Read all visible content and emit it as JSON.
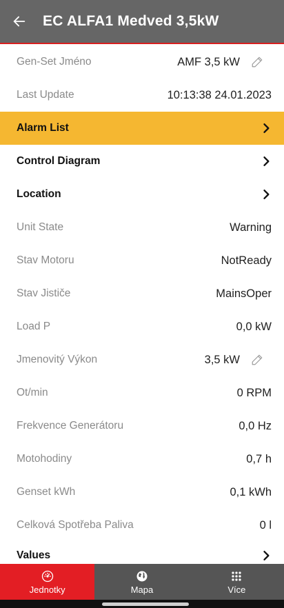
{
  "app_bar": {
    "title": "EC ALFA1 Medved 3,5kW",
    "back_icon": "arrow-left-icon"
  },
  "rows": {
    "genset_name": {
      "label": "Gen-Set Jméno",
      "value": "AMF 3,5 kW",
      "edit_icon": "pencil-icon"
    },
    "last_update": {
      "label": "Last Update",
      "value": "10:13:38 24.01.2023"
    },
    "alarm_list": {
      "label": "Alarm List",
      "icon": "chevron-right-icon",
      "highlight_color": "#f5b731"
    },
    "control_diagram": {
      "label": "Control Diagram",
      "icon": "chevron-right-icon"
    },
    "location": {
      "label": "Location",
      "icon": "chevron-right-icon"
    },
    "unit_state": {
      "label": "Unit State",
      "value": "Warning"
    },
    "stav_motoru": {
      "label": "Stav Motoru",
      "value": "NotReady"
    },
    "stav_jistice": {
      "label": "Stav Jističe",
      "value": "MainsOper"
    },
    "load_p": {
      "label": "Load P",
      "value": "0,0 kW"
    },
    "jmenovity_vykon": {
      "label": "Jmenovitý Výkon",
      "value": "3,5 kW",
      "edit_icon": "pencil-icon"
    },
    "ot_min": {
      "label": "Ot/min",
      "value": "0 RPM"
    },
    "frekvence": {
      "label": "Frekvence Generátoru",
      "value": "0,0 Hz"
    },
    "motohodiny": {
      "label": "Motohodiny",
      "value": "0,7 h"
    },
    "genset_kwh": {
      "label": "Genset kWh",
      "value": "0,1 kWh"
    },
    "spotreba": {
      "label": "Celková Spotřeba Paliva",
      "value": "0 l"
    },
    "values": {
      "label": "Values",
      "icon": "chevron-right-icon"
    }
  },
  "bottom_nav": {
    "jednotky": {
      "label": "Jednotky",
      "icon": "gauge-icon",
      "active": true
    },
    "mapa": {
      "label": "Mapa",
      "icon": "globe-icon"
    },
    "vice": {
      "label": "Více",
      "icon": "grid-dots-icon"
    }
  },
  "colors": {
    "app_bar": "#666666",
    "accent_red": "#e31e24",
    "alarm_highlight": "#f5b731",
    "bottom_nav": "#555555"
  }
}
